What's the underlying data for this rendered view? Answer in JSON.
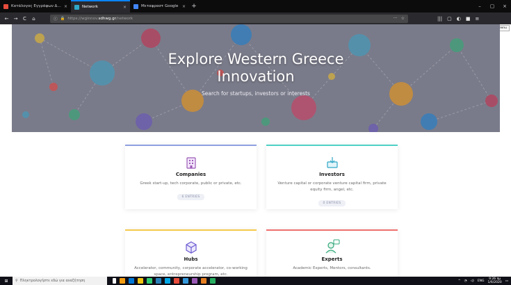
{
  "browser": {
    "tabs": [
      {
        "label": "Κατάλογος Εγγράφων Διαδικτύο",
        "favicon_color": "#e74c3c",
        "active": false
      },
      {
        "label": "Network",
        "favicon_color": "#2fa7c6",
        "active": true
      },
      {
        "label": "Μεταφραστ Google",
        "favicon_color": "#4285f4",
        "active": false
      }
    ],
    "tab_close": "×",
    "new_tab": "+",
    "window_controls": [
      "–",
      "▢",
      "×"
    ],
    "nav": {
      "back": "←",
      "forward": "→",
      "reload": "C",
      "home": "⌂"
    },
    "url": {
      "prefix": "https://wginnov.",
      "host": "sdhwg.gr",
      "path": "/network"
    },
    "url_icons": [
      "···",
      "☆"
    ],
    "toolbar_icons": [
      "|||",
      "▢",
      "◐",
      "■",
      "≡"
    ],
    "tooltip": "Open menu"
  },
  "hero": {
    "title_line1": "Explore Western Greece",
    "title_line2": "Innovation",
    "subtitle": "Search for startups, investors or interests"
  },
  "cards": [
    {
      "title": "Companies",
      "desc": "Greek start-up, tech corporate, public or private, etc.",
      "badge": "6 ENTRIES",
      "accent": "#8fa0e0",
      "icon": "building-icon",
      "icon_color": "#9b59b6"
    },
    {
      "title": "Investors",
      "desc": "Venture capital or corporate venture capital firm, private equity firm, angel, etc.",
      "badge": "0 ENTRIES",
      "accent": "#4fd1c5",
      "icon": "money-box-icon",
      "icon_color": "#2fa7c6"
    },
    {
      "title": "Hubs",
      "desc": "Accelerator, community, corporate accelerator, co-working space, entrepreneurship program, etc.",
      "badge": "",
      "accent": "#f6c84c",
      "icon": "cube-icon",
      "icon_color": "#6b5bd2"
    },
    {
      "title": "Experts",
      "desc": "Academic Experts, Mentors, consultants.",
      "badge": "",
      "accent": "#ef6f6f",
      "icon": "expert-icon",
      "icon_color": "#2fa77a"
    }
  ],
  "taskbar": {
    "start": "⊞",
    "search_placeholder": "Πληκτρολογήστε εδώ για αναζήτηση",
    "tray_lang": "ENG",
    "time": "9:26 πμ",
    "date": "1/6/2020",
    "app_colors": [
      "#ffffff",
      "#f39c12",
      "#0078d7",
      "#f1c40f",
      "#2ecc71",
      "#2980b9",
      "#00a8e8",
      "#e74c3c",
      "#3498db",
      "#9b59b6",
      "#e67e22",
      "#27ae60"
    ]
  }
}
